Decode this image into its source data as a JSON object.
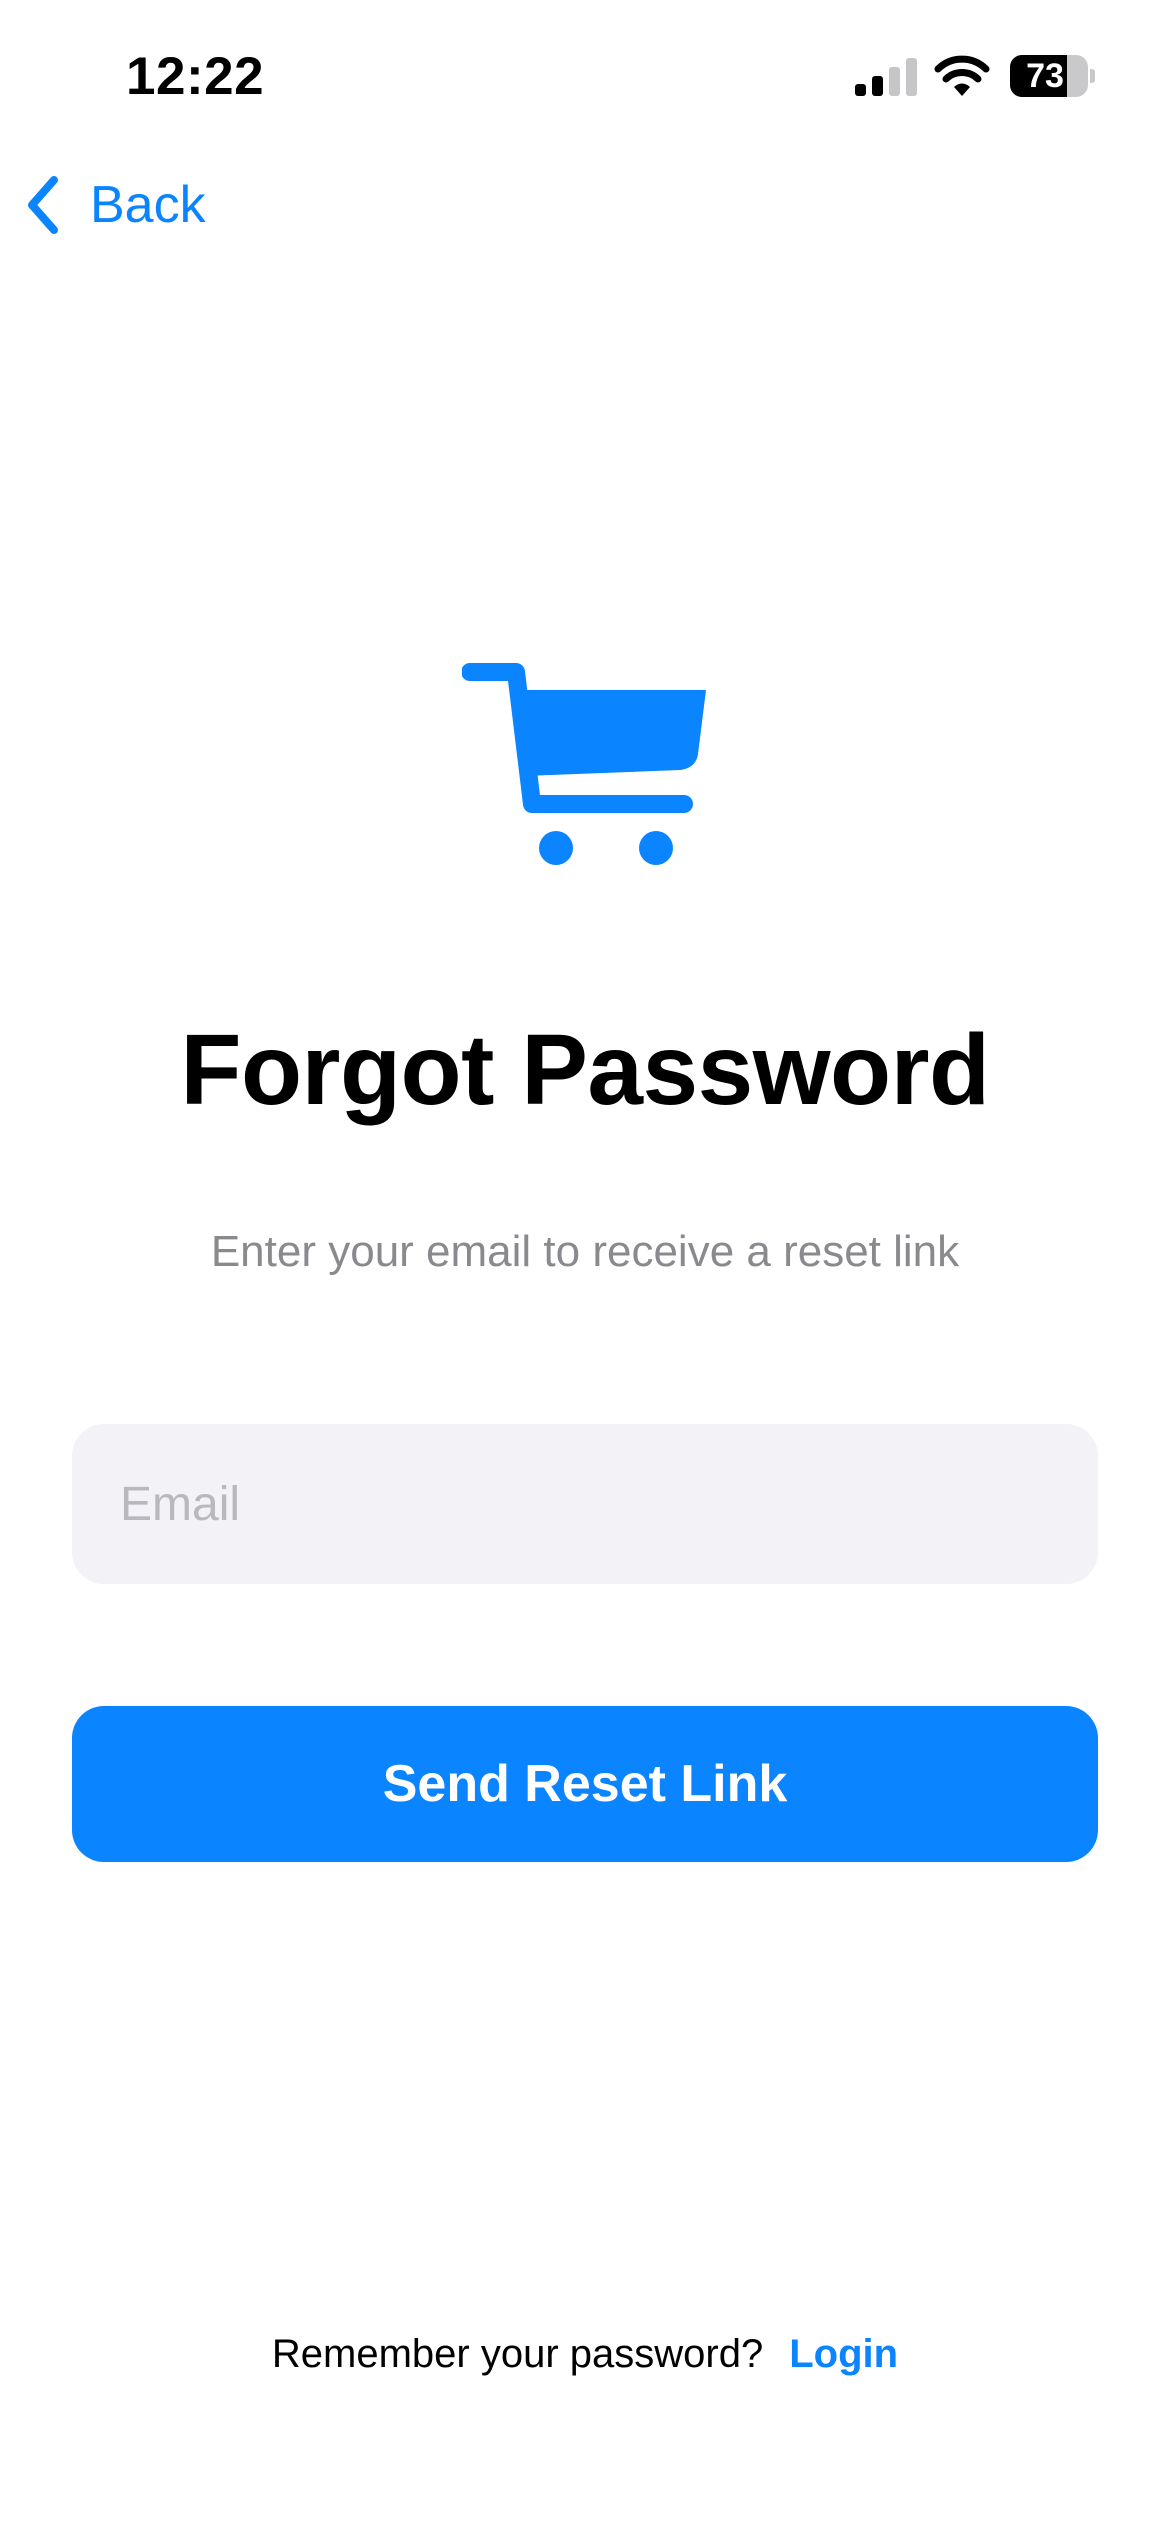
{
  "status_bar": {
    "time": "12:22",
    "battery_percent": "73",
    "battery_level": 0.73,
    "signal_icon": "cellular-signal-icon",
    "wifi_icon": "wifi-icon"
  },
  "nav": {
    "back_label": "Back",
    "back_icon": "chevron-left-icon"
  },
  "hero": {
    "icon": "shopping-cart-icon"
  },
  "title": "Forgot Password",
  "subtitle": "Enter your email to receive a reset link",
  "form": {
    "email_placeholder": "Email",
    "email_value": "",
    "submit_label": "Send Reset Link"
  },
  "footer": {
    "prompt": "Remember your password?",
    "login_label": "Login"
  },
  "colors": {
    "accent": "#0a84ff",
    "field_background": "#f2f2f7",
    "subtitle": "#8a8a8e",
    "placeholder": "#b8b8bd"
  }
}
